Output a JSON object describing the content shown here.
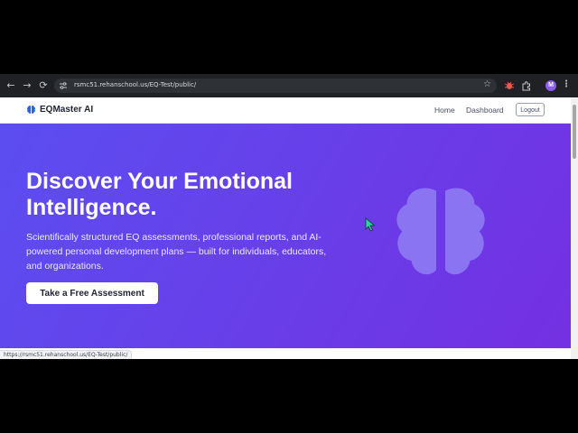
{
  "browser": {
    "url": "rsmc51.rehanschool.us/EQ-Test/public/",
    "back_glyph": "←",
    "forward_glyph": "→",
    "reload_glyph": "⟳",
    "star_glyph": "☆",
    "avatar_initial": "M",
    "menu_glyph": "⋮",
    "status_url": "https://rsmc51.rehanschool.us/EQ-Test/public/"
  },
  "nav": {
    "brand": "EQMaster AI",
    "home": "Home",
    "dashboard": "Dashboard",
    "logout": "Logout"
  },
  "hero": {
    "title": "Discover Your Emotional Intelligence.",
    "subtitle": "Scientifically structured EQ assessments, professional reports, and AI-powered personal development plans — built for individuals, educators, and organizations.",
    "cta": "Take a Free Assessment"
  },
  "colors": {
    "brand_icon": "#2563eb",
    "hero_start": "#5b4ef0",
    "hero_end": "#7430e2",
    "hero_brain": "#8b74f2",
    "cursor": "#2dd4a0"
  },
  "icons": {
    "brand": "brain-icon",
    "hero": "brain-icon",
    "extensions": [
      "bug-extension-icon",
      "puzzle-extensions-icon"
    ]
  }
}
